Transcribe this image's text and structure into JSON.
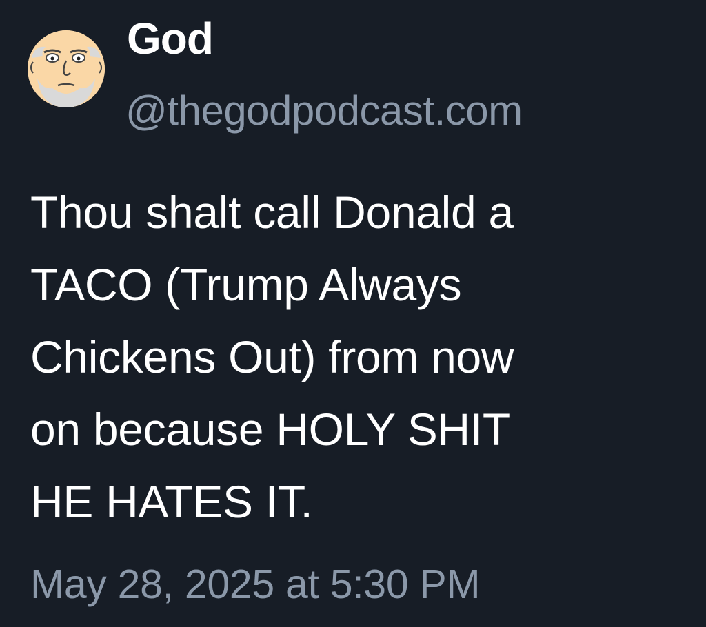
{
  "post": {
    "author": {
      "display_name": "God",
      "handle": "@thegodpodcast.com",
      "avatar_icon": "cartoon-face-avatar"
    },
    "text_lines": [
      "Thou shalt call Donald a",
      "TACO (Trump Always",
      "Chickens Out) from now",
      "on because HOLY SHIT",
      "HE HATES IT."
    ],
    "timestamp": "May 28, 2025 at 5:30 PM"
  },
  "colors": {
    "background": "#171d26",
    "primary_text": "#ffffff",
    "secondary_text": "#8b98a9"
  }
}
